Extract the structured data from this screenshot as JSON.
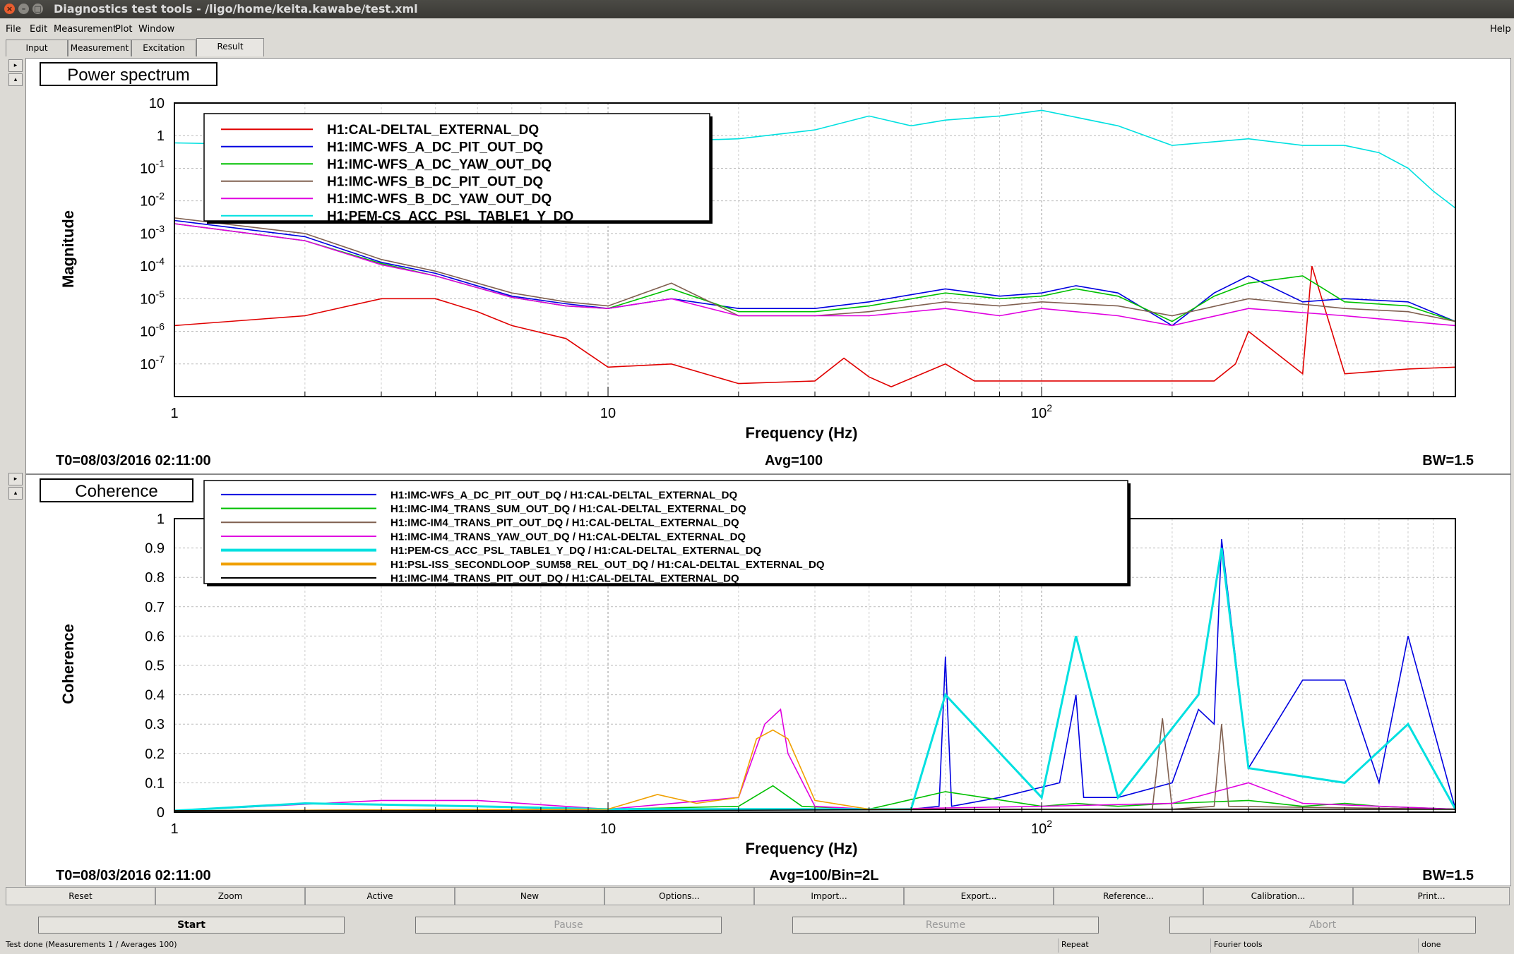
{
  "window": {
    "title": "Diagnostics test tools - /ligo/home/keita.kawabe/test.xml"
  },
  "menu": {
    "items": [
      "File",
      "Edit",
      "Measurement",
      "Plot",
      "Window"
    ],
    "help": "Help"
  },
  "tabs": [
    "Input",
    "Measurement",
    "Excitation",
    "Result"
  ],
  "active_tab": "Result",
  "colors": {
    "red": "#e00000",
    "blue": "#0000e0",
    "green": "#00c000",
    "brown": "#806050",
    "magenta": "#e000e0",
    "cyan": "#00e0e0",
    "orange": "#f0a000",
    "black": "#000000"
  },
  "plots": {
    "power": {
      "header": "Power spectrum",
      "ylabel": "Magnitude",
      "xlabel": "Frequency (Hz)",
      "t0": "T0=08/03/2016 02:11:00",
      "avg": "Avg=100",
      "bw": "BW=1.5",
      "yticks": [
        {
          "base": "10",
          "exp": ""
        },
        {
          "base": "1",
          "exp": ""
        },
        {
          "base": "10",
          "exp": "-1"
        },
        {
          "base": "10",
          "exp": "-2"
        },
        {
          "base": "10",
          "exp": "-3"
        },
        {
          "base": "10",
          "exp": "-4"
        },
        {
          "base": "10",
          "exp": "-5"
        },
        {
          "base": "10",
          "exp": "-6"
        },
        {
          "base": "10",
          "exp": "-7"
        }
      ],
      "xticks": [
        {
          "base": "1",
          "exp": ""
        },
        {
          "base": "10",
          "exp": ""
        },
        {
          "base": "10",
          "exp": "2"
        }
      ],
      "legend": [
        {
          "label": "H1:CAL-DELTAL_EXTERNAL_DQ",
          "color": "#e00000"
        },
        {
          "label": "H1:IMC-WFS_A_DC_PIT_OUT_DQ",
          "color": "#0000e0"
        },
        {
          "label": "H1:IMC-WFS_A_DC_YAW_OUT_DQ",
          "color": "#00c000"
        },
        {
          "label": "H1:IMC-WFS_B_DC_PIT_OUT_DQ",
          "color": "#806050"
        },
        {
          "label": "H1:IMC-WFS_B_DC_YAW_OUT_DQ",
          "color": "#e000e0"
        },
        {
          "label": "H1:PEM-CS_ACC_PSL_TABLE1_Y_DQ",
          "color": "#00e0e0"
        }
      ]
    },
    "coherence": {
      "header": "Coherence",
      "ylabel": "Coherence",
      "xlabel": "Frequency (Hz)",
      "t0": "T0=08/03/2016 02:11:00",
      "avg": "Avg=100/Bin=2L",
      "bw": "BW=1.5",
      "yticks": [
        "1",
        "0.9",
        "0.8",
        "0.7",
        "0.6",
        "0.5",
        "0.4",
        "0.3",
        "0.2",
        "0.1",
        "0"
      ],
      "xticks": [
        {
          "base": "1",
          "exp": ""
        },
        {
          "base": "10",
          "exp": ""
        },
        {
          "base": "10",
          "exp": "2"
        }
      ],
      "legend": [
        {
          "label": "H1:IMC-WFS_A_DC_PIT_OUT_DQ / H1:CAL-DELTAL_EXTERNAL_DQ",
          "color": "#0000e0"
        },
        {
          "label": "H1:IMC-IM4_TRANS_SUM_OUT_DQ / H1:CAL-DELTAL_EXTERNAL_DQ",
          "color": "#00c000"
        },
        {
          "label": "H1:IMC-IM4_TRANS_PIT_OUT_DQ / H1:CAL-DELTAL_EXTERNAL_DQ",
          "color": "#806050"
        },
        {
          "label": "H1:IMC-IM4_TRANS_YAW_OUT_DQ / H1:CAL-DELTAL_EXTERNAL_DQ",
          "color": "#e000e0"
        },
        {
          "label": "H1:PEM-CS_ACC_PSL_TABLE1_Y_DQ / H1:CAL-DELTAL_EXTERNAL_DQ",
          "color": "#00e0e0"
        },
        {
          "label": "H1:PSL-ISS_SECONDLOOP_SUM58_REL_OUT_DQ / H1:CAL-DELTAL_EXTERNAL_DQ",
          "color": "#f0a000"
        },
        {
          "label": "H1:IMC-IM4_TRANS_PIT_OUT_DQ / H1:CAL-DELTAL_EXTERNAL_DQ",
          "color": "#000000"
        }
      ]
    }
  },
  "chart_data": [
    {
      "type": "line",
      "title": "Power spectrum",
      "xlabel": "Frequency (Hz)",
      "ylabel": "Magnitude",
      "xscale": "log",
      "yscale": "log",
      "xlim": [
        1,
        900
      ],
      "ylim": [
        1e-08,
        10
      ],
      "grid": true,
      "legend_position": "top-left",
      "series": [
        {
          "name": "H1:CAL-DELTAL_EXTERNAL_DQ",
          "x": [
            1,
            2,
            3,
            4,
            5,
            6,
            8,
            10,
            14,
            20,
            30,
            35,
            40,
            45,
            60,
            70,
            100,
            150,
            200,
            250,
            280,
            300,
            400,
            420,
            500,
            700,
            900
          ],
          "y": [
            1.5e-06,
            3e-06,
            1e-05,
            1e-05,
            4e-06,
            1.5e-06,
            6e-07,
            8e-08,
            1e-07,
            2.5e-08,
            3e-08,
            1.5e-07,
            4e-08,
            2e-08,
            1e-07,
            3e-08,
            3e-08,
            3e-08,
            3e-08,
            3e-08,
            1e-07,
            1e-06,
            5e-08,
            0.0001,
            5e-08,
            7e-08,
            8e-08
          ]
        },
        {
          "name": "H1:IMC-WFS_A_DC_PIT_OUT_DQ",
          "x": [
            1,
            2,
            3,
            4,
            6,
            8,
            10,
            14,
            20,
            30,
            40,
            60,
            80,
            100,
            120,
            150,
            200,
            250,
            300,
            400,
            500,
            700,
            900
          ],
          "y": [
            0.0025,
            0.0008,
            0.00013,
            6e-05,
            1.2e-05,
            7e-06,
            5e-06,
            1e-05,
            5e-06,
            5e-06,
            8e-06,
            2e-05,
            1.2e-05,
            1.5e-05,
            2.5e-05,
            1.5e-05,
            1.5e-06,
            1.5e-05,
            5e-05,
            8e-06,
            1e-05,
            8e-06,
            2e-06
          ]
        },
        {
          "name": "H1:IMC-WFS_A_DC_YAW_OUT_DQ",
          "x": [
            1,
            2,
            3,
            4,
            6,
            8,
            10,
            14,
            20,
            30,
            40,
            60,
            80,
            100,
            120,
            150,
            200,
            250,
            300,
            400,
            500,
            700,
            900
          ],
          "y": [
            0.002,
            0.0006,
            0.00012,
            5e-05,
            1.1e-05,
            6e-06,
            5e-06,
            2e-05,
            4e-06,
            4e-06,
            6e-06,
            1.5e-05,
            1e-05,
            1.2e-05,
            2e-05,
            1.2e-05,
            2e-06,
            1.2e-05,
            3e-05,
            5e-05,
            8e-06,
            6e-06,
            2e-06
          ]
        },
        {
          "name": "H1:IMC-WFS_B_DC_PIT_OUT_DQ",
          "x": [
            1,
            2,
            3,
            4,
            6,
            8,
            10,
            14,
            20,
            30,
            40,
            60,
            80,
            100,
            150,
            200,
            300,
            500,
            700,
            900
          ],
          "y": [
            0.003,
            0.001,
            0.00016,
            7e-05,
            1.5e-05,
            8e-06,
            6e-06,
            3e-05,
            3e-06,
            3e-06,
            4e-06,
            8e-06,
            6e-06,
            8e-06,
            6e-06,
            3e-06,
            1e-05,
            5e-06,
            4e-06,
            2e-06
          ]
        },
        {
          "name": "H1:IMC-WFS_B_DC_YAW_OUT_DQ",
          "x": [
            1,
            2,
            3,
            4,
            6,
            8,
            10,
            14,
            20,
            30,
            40,
            60,
            80,
            100,
            150,
            200,
            300,
            500,
            700,
            900
          ],
          "y": [
            0.002,
            0.0006,
            0.00011,
            5e-05,
            1.1e-05,
            6e-06,
            5e-06,
            1e-05,
            3e-06,
            3e-06,
            3e-06,
            5e-06,
            3e-06,
            5e-06,
            3e-06,
            1.5e-06,
            5e-06,
            3e-06,
            2e-06,
            1.5e-06
          ]
        },
        {
          "name": "H1:PEM-CS_ACC_PSL_TABLE1_Y_DQ",
          "x": [
            1,
            2,
            5,
            10,
            20,
            30,
            40,
            50,
            60,
            80,
            100,
            150,
            200,
            300,
            400,
            500,
            600,
            700,
            800,
            900
          ],
          "y": [
            0.6,
            0.5,
            0.6,
            0.6,
            0.8,
            1.5,
            4,
            2,
            3,
            4,
            6,
            2,
            0.5,
            0.8,
            0.5,
            0.5,
            0.3,
            0.1,
            0.02,
            0.006
          ]
        }
      ]
    },
    {
      "type": "line",
      "title": "Coherence",
      "xlabel": "Frequency (Hz)",
      "ylabel": "Coherence",
      "xscale": "log",
      "xlim": [
        1,
        900
      ],
      "ylim": [
        0,
        1
      ],
      "grid": true,
      "legend_position": "top-left",
      "series": [
        {
          "name": "H1:IMC-WFS_A_DC_PIT_OUT_DQ / H1:CAL-DELTAL_EXTERNAL_DQ",
          "x": [
            1,
            10,
            50,
            58,
            60,
            62,
            80,
            110,
            120,
            125,
            150,
            200,
            230,
            250,
            260,
            300,
            400,
            500,
            600,
            700,
            900
          ],
          "y": [
            0.005,
            0.01,
            0.01,
            0.02,
            0.53,
            0.02,
            0.05,
            0.1,
            0.4,
            0.05,
            0.05,
            0.1,
            0.35,
            0.3,
            0.93,
            0.15,
            0.45,
            0.45,
            0.1,
            0.6,
            0.01
          ]
        },
        {
          "name": "H1:IMC-IM4_TRANS_SUM_OUT_DQ / H1:CAL-DELTAL_EXTERNAL_DQ",
          "x": [
            1,
            10,
            20,
            24,
            28,
            40,
            60,
            100,
            120,
            150,
            200,
            300,
            400,
            500,
            600,
            900
          ],
          "y": [
            0.005,
            0.01,
            0.02,
            0.09,
            0.02,
            0.01,
            0.07,
            0.02,
            0.03,
            0.02,
            0.03,
            0.04,
            0.02,
            0.03,
            0.02,
            0.01
          ]
        },
        {
          "name": "H1:IMC-IM4_TRANS_PIT_OUT_DQ / H1:CAL-DELTAL_EXTERNAL_DQ",
          "x": [
            1,
            10,
            100,
            180,
            190,
            200,
            250,
            260,
            270,
            900
          ],
          "y": [
            0.005,
            0.01,
            0.01,
            0.01,
            0.32,
            0.01,
            0.02,
            0.3,
            0.02,
            0.01
          ]
        },
        {
          "name": "H1:IMC-IM4_TRANS_YAW_OUT_DQ / H1:CAL-DELTAL_EXTERNAL_DQ",
          "x": [
            1,
            3,
            5,
            10,
            20,
            23,
            25,
            26,
            30,
            40,
            100,
            200,
            300,
            400,
            900
          ],
          "y": [
            0.005,
            0.04,
            0.04,
            0.01,
            0.05,
            0.3,
            0.35,
            0.2,
            0.02,
            0.01,
            0.02,
            0.03,
            0.1,
            0.03,
            0.01
          ]
        },
        {
          "name": "H1:PEM-CS_ACC_PSL_TABLE1_Y_DQ / H1:CAL-DELTAL_EXTERNAL_DQ",
          "x": [
            1,
            2,
            5,
            10,
            50,
            60,
            100,
            120,
            150,
            230,
            260,
            300,
            500,
            700,
            900
          ],
          "y": [
            0.005,
            0.03,
            0.02,
            0.01,
            0.01,
            0.4,
            0.05,
            0.6,
            0.05,
            0.4,
            0.9,
            0.15,
            0.1,
            0.3,
            0.01
          ]
        },
        {
          "name": "H1:PSL-ISS_SECONDLOOP_SUM58_REL_OUT_DQ / H1:CAL-DELTAL_EXTERNAL_DQ",
          "x": [
            1,
            10,
            13,
            16,
            20,
            22,
            24,
            26,
            30,
            40,
            900
          ],
          "y": [
            0.005,
            0.01,
            0.06,
            0.03,
            0.05,
            0.25,
            0.28,
            0.25,
            0.04,
            0.01,
            0.01
          ]
        },
        {
          "name": "H1:IMC-IM4_TRANS_PIT_OUT_DQ / H1:CAL-DELTAL_EXTERNAL_DQ",
          "x": [
            1,
            10,
            100,
            900
          ],
          "y": [
            0.005,
            0.005,
            0.01,
            0.01
          ]
        }
      ]
    }
  ],
  "toolbar": [
    "Reset",
    "Zoom",
    "Active",
    "New",
    "Options...",
    "Import...",
    "Export...",
    "Reference...",
    "Calibration...",
    "Print..."
  ],
  "controls": {
    "start": "Start",
    "pause": "Pause",
    "resume": "Resume",
    "abort": "Abort"
  },
  "status": {
    "message": "Test done (Measurements 1 / Averages 100)",
    "repeat": "Repeat",
    "fourier": "Fourier tools",
    "done": "done"
  }
}
